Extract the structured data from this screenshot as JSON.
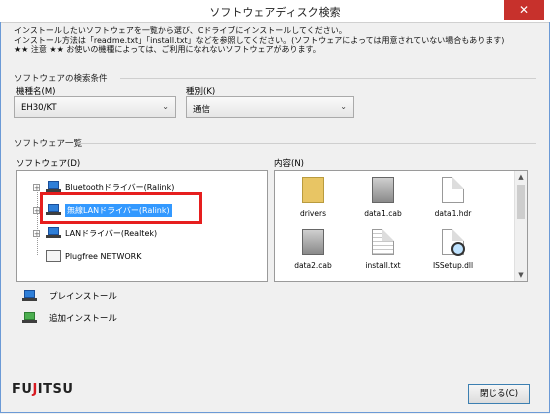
{
  "window": {
    "title": "ソフトウェアディスク検索",
    "close_label": "✕"
  },
  "intro": {
    "line1": "インストールしたいソフトウェアを一覧から選び、Cドライブにインストールしてください。",
    "line2": "インストール方法は「readme.txt」「install.txt」などを参照してください。(ソフトウェアによっては用意されていない場合もあります)",
    "line3": "★★ 注意 ★★ お使いの機種によっては、ご利用になれないソフトウェアがあります。"
  },
  "search_conditions": {
    "group_label": "ソフトウェアの検索条件",
    "model_label": "機種名(M)",
    "model_value": "EH30/KT",
    "type_label": "種別(K)",
    "type_value": "通信"
  },
  "software_list": {
    "group_label": "ソフトウェア一覧",
    "tree_label": "ソフトウェア(D)",
    "contents_label": "内容(N)",
    "tree_items": [
      {
        "label": "Bluetoothドライバー(Ralink)",
        "expander": "+"
      },
      {
        "label": "無線LANドライバー(Ralink)",
        "expander": "+"
      },
      {
        "label": "LANドライバー(Realtek)",
        "expander": "+"
      },
      {
        "label": "Plugfree NETWORK"
      }
    ],
    "files": [
      {
        "name": "drivers",
        "icon": "folder-icon"
      },
      {
        "name": "data1.cab",
        "icon": "archive-icon"
      },
      {
        "name": "data1.hdr",
        "icon": "document-icon"
      },
      {
        "name": "data2.cab",
        "icon": "archive-icon"
      },
      {
        "name": "install.txt",
        "icon": "text-file-icon"
      },
      {
        "name": "ISSetup.dll",
        "icon": "setup-dll-icon"
      }
    ]
  },
  "actions": {
    "preinstall_label": "プレインストール",
    "add_install_label": "追加インストール"
  },
  "footer": {
    "logo_text_pre": "FU",
    "logo_text_j": "J",
    "logo_text_post": "ITSU",
    "close_button": "閉じる(C)"
  },
  "colors": {
    "selection_highlight": "#e61e1e",
    "selected_bg": "#3399ff",
    "close_red": "#c7312c"
  }
}
